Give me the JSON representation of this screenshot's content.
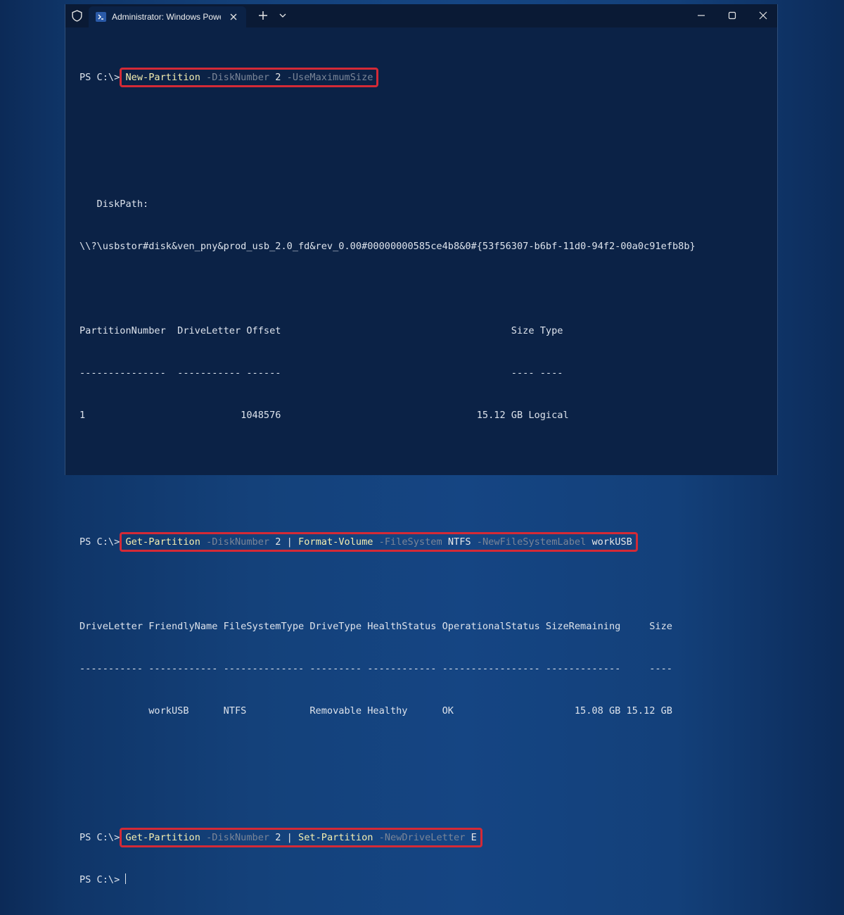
{
  "window": {
    "tab_title": "Administrator: Windows PowerShell",
    "icons": {
      "shield": "shield-icon",
      "app": "powershell-icon",
      "tab_close": "close-icon",
      "new_tab": "plus-icon",
      "tab_dropdown": "chevron-down-icon",
      "minimize": "minimize-icon",
      "maximize": "maximize-icon",
      "close": "close-icon"
    }
  },
  "colors": {
    "background": "#0b2246",
    "highlight_border": "#d42a36",
    "cmdlet": "#f4eeb0",
    "parameter": "#7a8597",
    "text": "#dde3ec"
  },
  "terminal": {
    "prompt": "PS C:\\>",
    "cmd1": {
      "cmdlet": "New-Partition",
      "p1": "-DiskNumber",
      "v1": "2",
      "p2": "-UseMaximumSize"
    },
    "diskpath_label": "   DiskPath:",
    "diskpath_value": "\\\\?\\usbstor#disk&ven_pny&prod_usb_2.0_fd&rev_0.00#00000000585ce4b8&0#{53f56307-b6bf-11d0-94f2-00a0c91efb8b}",
    "table1": {
      "header": "PartitionNumber  DriveLetter Offset                                        Size Type",
      "sep": "---------------  ----------- ------                                        ---- ----",
      "row": "1                           1048576                                  15.12 GB Logical"
    },
    "cmd2": {
      "cmdlet1": "Get-Partition",
      "p1": "-DiskNumber",
      "v1": "2",
      "pipe": "|",
      "cmdlet2": "Format-Volume",
      "p2": "-FileSystem",
      "v2": "NTFS",
      "p3": "-NewFileSystemLabel",
      "v3": "workUSB"
    },
    "table2": {
      "header": "DriveLetter FriendlyName FileSystemType DriveType HealthStatus OperationalStatus SizeRemaining     Size",
      "sep": "----------- ------------ -------------- --------- ------------ ----------------- -------------     ----",
      "row": "            workUSB      NTFS           Removable Healthy      OK                     15.08 GB 15.12 GB"
    },
    "cmd3": {
      "cmdlet1": "Get-Partition",
      "p1": "-DiskNumber",
      "v1": "2",
      "pipe": "|",
      "cmdlet2": "Set-Partition",
      "p2": "-NewDriveLetter",
      "v2": "E"
    }
  }
}
